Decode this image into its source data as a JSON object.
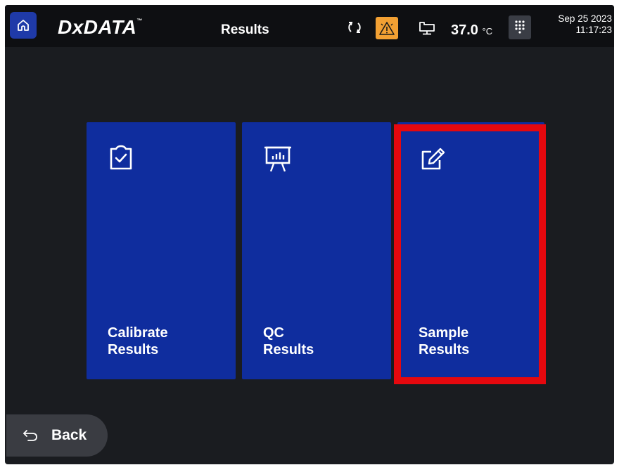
{
  "header": {
    "brand": "DxDATA",
    "brand_mark": "™",
    "title": "Results",
    "temperature": "37.0",
    "temperature_unit": "°C",
    "date": "Sep 25 2023",
    "time": "11:17:23",
    "icons": [
      "home-icon",
      "sync-icon",
      "warning-icon",
      "device-icon",
      "keypad-icon"
    ],
    "alert_color": "#f2a033"
  },
  "tiles": [
    {
      "line1": "Calibrate",
      "line2": "Results",
      "icon": "clipboard-check-icon"
    },
    {
      "line1": "QC",
      "line2": "Results",
      "icon": "presentation-chart-icon"
    },
    {
      "line1": "Sample",
      "line2": "Results",
      "icon": "edit-pen-icon",
      "highlighted": true
    }
  ],
  "footer": {
    "back_label": "Back",
    "icon": "back-arrow-icon"
  },
  "colors": {
    "tile": "#0f2d9e",
    "highlight": "#e5080e",
    "background": "#1a1c20"
  }
}
